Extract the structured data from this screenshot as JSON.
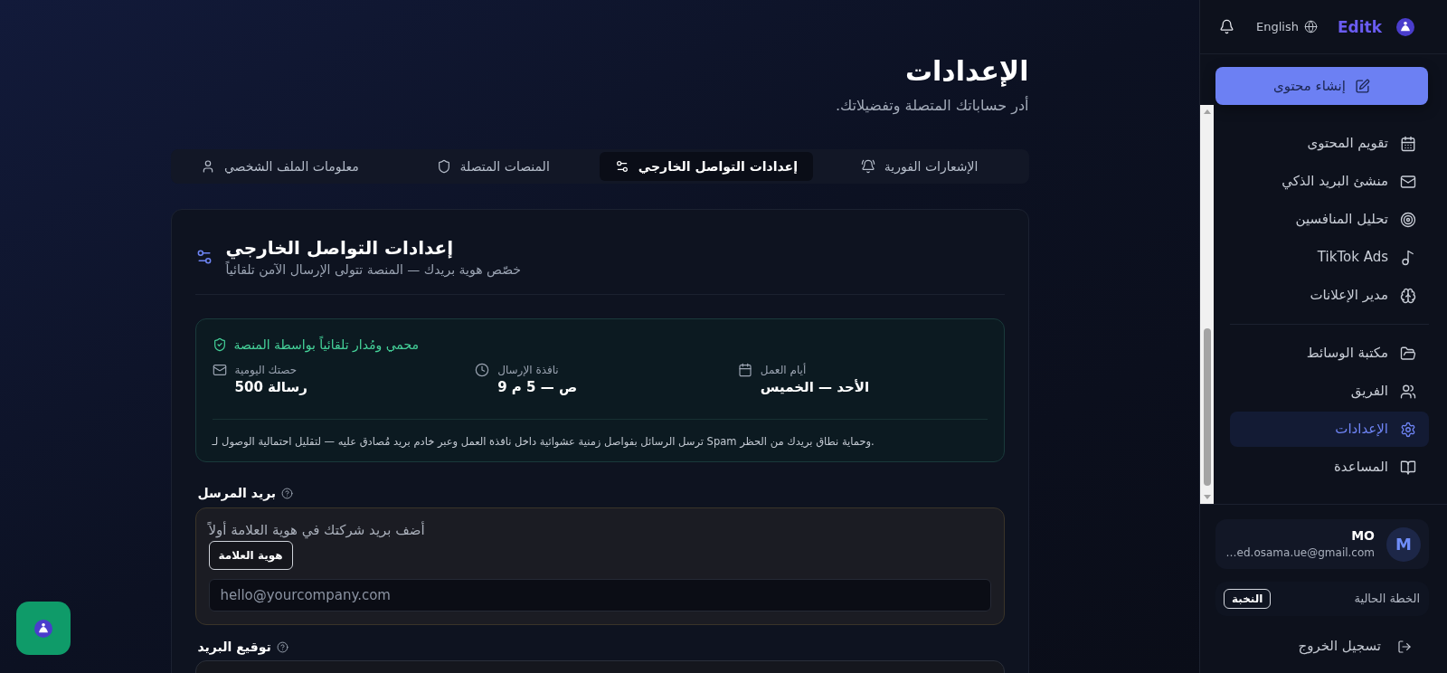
{
  "sidebar": {
    "language": "English",
    "brand": "Editk",
    "create_button": "إنشاء محتوى",
    "nav": {
      "groups": [
        {
          "items": [
            {
              "label": "تقويم المحتوى",
              "selected": false
            },
            {
              "label": "منشئ البريد الذكي",
              "selected": false
            },
            {
              "label": "تحليل المنافسين",
              "selected": false
            },
            {
              "label": "TikTok Ads",
              "selected": false
            },
            {
              "label": "مدير الإعلانات",
              "selected": false
            }
          ]
        },
        {
          "items": [
            {
              "label": "مكتبة الوسائط",
              "selected": false
            },
            {
              "label": "الفريق",
              "selected": false
            },
            {
              "label": "الإعدادات",
              "selected": true
            },
            {
              "label": "المساعدة",
              "selected": false
            }
          ]
        }
      ]
    },
    "user": {
      "initial": "M",
      "name": "MO",
      "email": "…ed.osama.ue@gmail.com"
    },
    "plan": {
      "label": "الخطة الحالية",
      "badge": "النخبة"
    },
    "logout": "تسجيل الخروج"
  },
  "page": {
    "title": "الإعدادات",
    "subtitle": "أدر حساباتك المتصلة وتفضيلاتك."
  },
  "tabs": [
    {
      "label": "الإشعارات الفورية",
      "selected": false
    },
    {
      "label": "إعدادات التواصل الخارجي",
      "selected": true
    },
    {
      "label": "المنصات المتصلة",
      "selected": false
    },
    {
      "label": "معلومات الملف الشخصي",
      "selected": false
    }
  ],
  "card": {
    "title": "إعدادات التواصل الخارجي",
    "subtitle": "خصّص هوية بريدك — المنصة تتولى الإرسال الآمن تلقائياً",
    "notice": {
      "heading": "محمي ومُدار تلقائياً بواسطة المنصة",
      "stats": [
        {
          "label": "أيام العمل",
          "value": "الأحد — الخميس"
        },
        {
          "label": "نافذة الإرسال",
          "value": "9 ص — 5 م"
        },
        {
          "label": "حصتك اليومية",
          "value": "500 رسالة"
        }
      ],
      "note": "ترسل الرسائل بفواصل زمنية عشوائية داخل نافذة العمل وعبر خادم بريد مُصادق عليه — لتقليل احتمالية الوصول لـ Spam وحماية نطاق بريدك من الحظر."
    },
    "fields": [
      {
        "kind": "email",
        "label": "بريد المرسل",
        "hint": "أضف بريد شركتك في هوية العلامة أولاً",
        "button": "هوية العلامة",
        "placeholder": "hello@yourcompany.com"
      },
      {
        "kind": "textarea",
        "label": "توقيع البريد"
      }
    ]
  }
}
